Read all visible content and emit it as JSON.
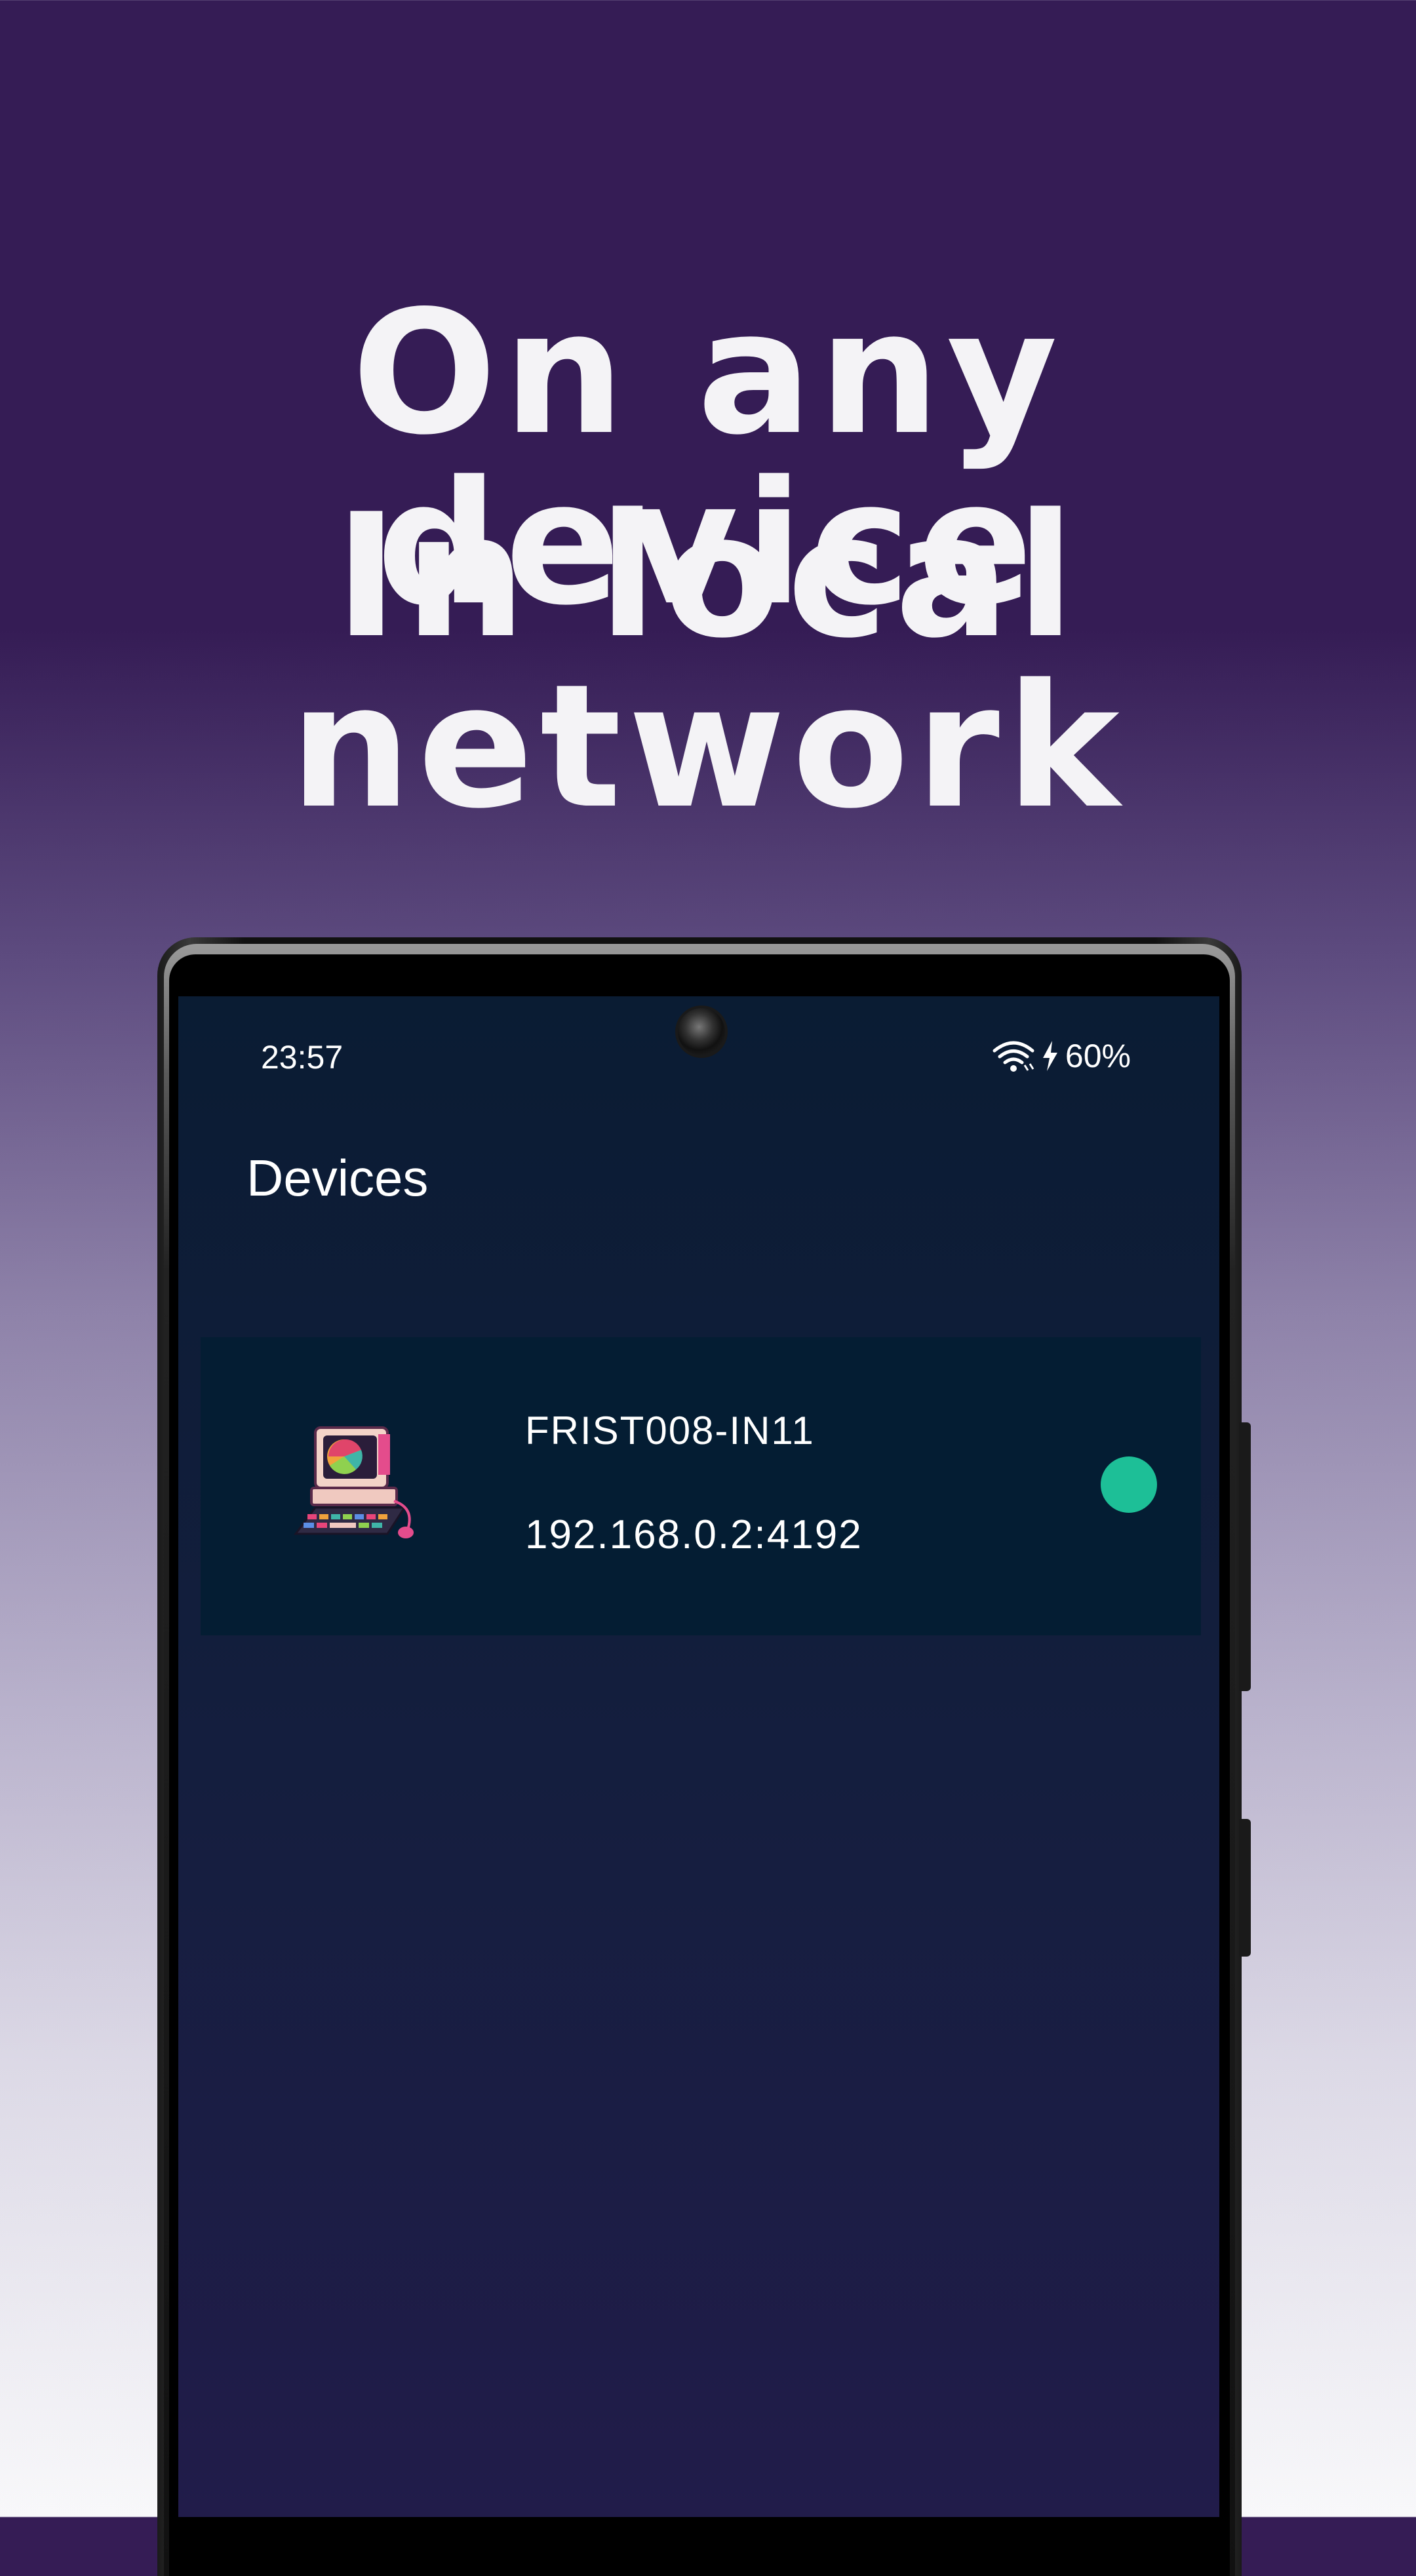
{
  "headline": {
    "line1": "On any device",
    "line2": "In local network"
  },
  "status_bar": {
    "time": "23:57",
    "battery": "60%",
    "icons": [
      "wifi-icon",
      "charging-bolt-icon"
    ]
  },
  "screen": {
    "title": "Devices",
    "devices": [
      {
        "name": "FRIST008-IN11",
        "address": "192.168.0.2:4192",
        "status": "online",
        "status_color": "#1dbf97",
        "icon": "retro-computer-icon"
      }
    ]
  },
  "colors": {
    "background_top": "#351c55",
    "screen_background": "#0a1c33",
    "row_background": "#041d33",
    "online": "#1dbf97"
  }
}
